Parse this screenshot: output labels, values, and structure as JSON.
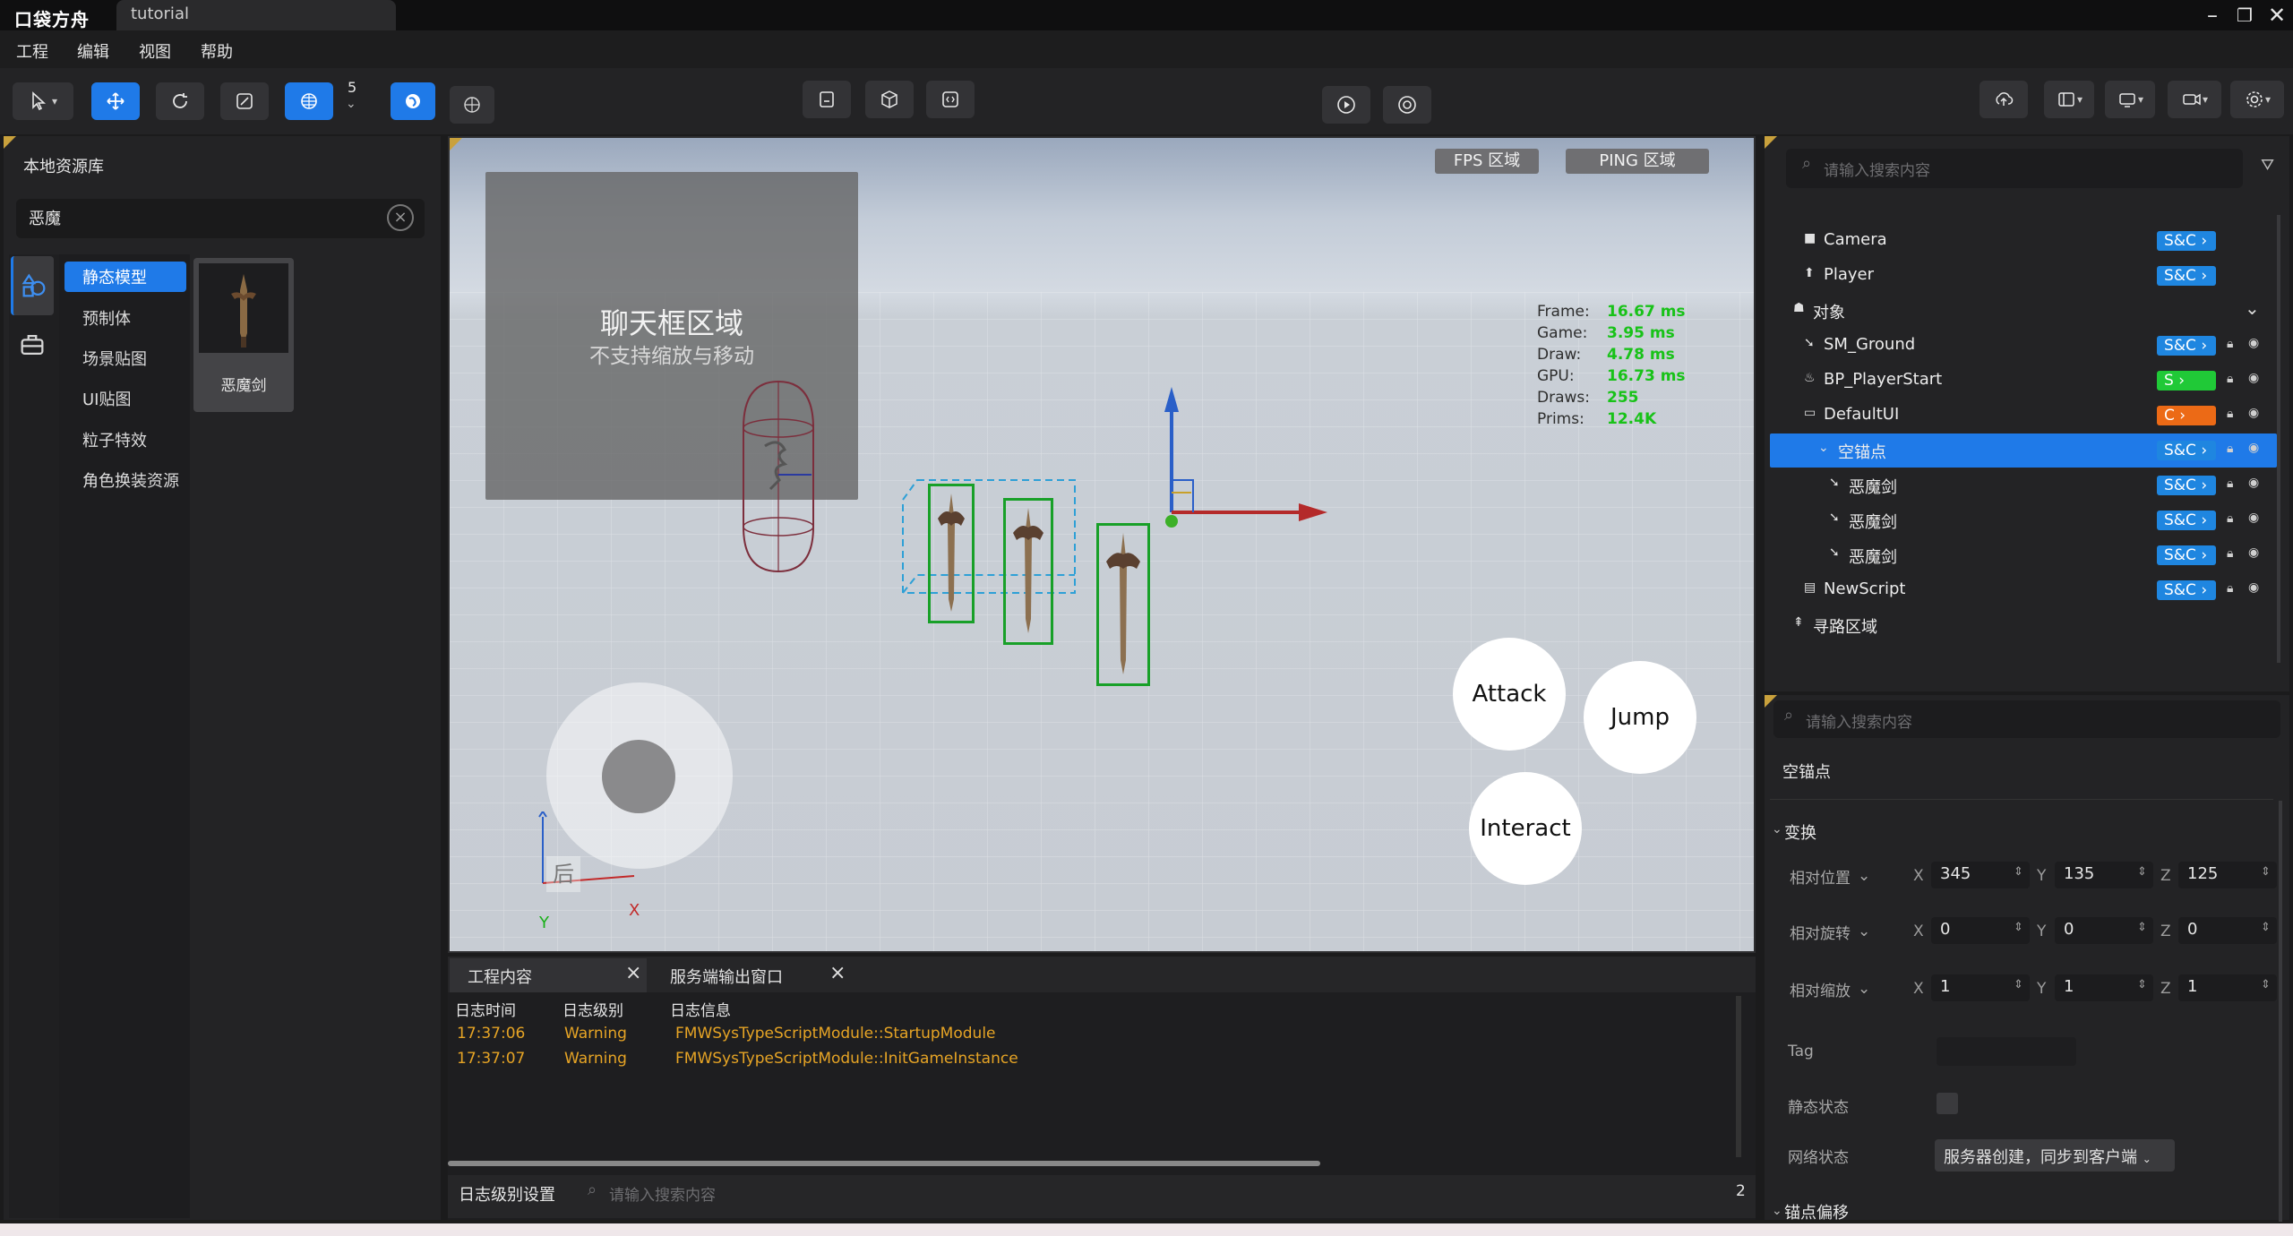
{
  "app": {
    "logo": "口袋方舟",
    "doc_tab": "tutorial"
  },
  "menu": [
    "工程",
    "编辑",
    "视图",
    "帮助"
  ],
  "toolbar": {
    "snap_value": "5"
  },
  "asset_library": {
    "title": "本地资源库",
    "search_value": "恶魔",
    "categories": [
      "静态模型",
      "预制体",
      "场景贴图",
      "UI贴图",
      "粒子特效",
      "角色换装资源"
    ],
    "active_category": "静态模型",
    "assets": [
      {
        "name": "恶魔剑"
      }
    ]
  },
  "viewport": {
    "fps_tag": "FPS 区域",
    "ping_tag": "PING 区域",
    "chat_title": "聊天框区域",
    "chat_subtitle": "不支持缩放与移动",
    "stats": [
      {
        "label": "Frame:",
        "value": "16.67 ms"
      },
      {
        "label": "Game:",
        "value": "3.95 ms"
      },
      {
        "label": "Draw:",
        "value": "4.78 ms"
      },
      {
        "label": "GPU:",
        "value": "16.73 ms"
      },
      {
        "label": "Draws:",
        "value": "255"
      },
      {
        "label": "Prims:",
        "value": "12.4K"
      }
    ],
    "buttons": {
      "attack": "Attack",
      "jump": "Jump",
      "interact": "Interact"
    },
    "joystick_back": "后",
    "axis_x": "X",
    "axis_y": "Y"
  },
  "log": {
    "tabs": [
      "工程内容",
      "服务端输出窗口"
    ],
    "headers": [
      "日志时间",
      "日志级别",
      "日志信息"
    ],
    "rows": [
      {
        "time": "17:37:06",
        "level": "Warning",
        "message": "FMWSysTypeScriptModule::StartupModule"
      },
      {
        "time": "17:37:07",
        "level": "Warning",
        "message": "FMWSysTypeScriptModule::InitGameInstance"
      }
    ],
    "level_settings": "日志级别设置",
    "search_placeholder": "请输入搜索内容",
    "count": "2"
  },
  "outliner": {
    "search_placeholder": "请输入搜索内容",
    "items": [
      {
        "label": "Camera",
        "badge": "S&C",
        "badge_color": "#1f86e0"
      },
      {
        "label": "Player",
        "badge": "S&C",
        "badge_color": "#1f86e0"
      },
      {
        "label": "对象",
        "badge": ""
      },
      {
        "label": "SM_Ground",
        "badge": "S&C",
        "badge_color": "#1f86e0"
      },
      {
        "label": "BP_PlayerStart",
        "badge": "S",
        "badge_color": "#20c937"
      },
      {
        "label": "DefaultUI",
        "badge": "C",
        "badge_color": "#ec6a16"
      },
      {
        "label": "空锚点",
        "badge": "S&C",
        "badge_color": "#1f86e0",
        "selected": true
      },
      {
        "label": "恶魔剑",
        "badge": "S&C",
        "badge_color": "#1f86e0"
      },
      {
        "label": "恶魔剑",
        "badge": "S&C",
        "badge_color": "#1f86e0"
      },
      {
        "label": "恶魔剑",
        "badge": "S&C",
        "badge_color": "#1f86e0"
      },
      {
        "label": "NewScript",
        "badge": "S&C",
        "badge_color": "#1f86e0"
      },
      {
        "label": "寻路区域",
        "badge": ""
      }
    ]
  },
  "details": {
    "search_placeholder": "请输入搜索内容",
    "object_name": "空锚点",
    "section_transform": "变换",
    "rows": [
      {
        "label": "相对位置",
        "x": "345",
        "y": "135",
        "z": "125"
      },
      {
        "label": "相对旋转",
        "x": "0",
        "y": "0",
        "z": "0"
      },
      {
        "label": "相对缩放",
        "x": "1",
        "y": "1",
        "z": "1"
      }
    ],
    "tag_label": "Tag",
    "static_label": "静态状态",
    "network_label": "网络状态",
    "network_value": "服务器创建，同步到客户端",
    "section_anchor": "锚点偏移"
  },
  "colors": {
    "accent": "#1f7ae8",
    "warning": "#e6a425",
    "stat_green": "#18c218"
  }
}
